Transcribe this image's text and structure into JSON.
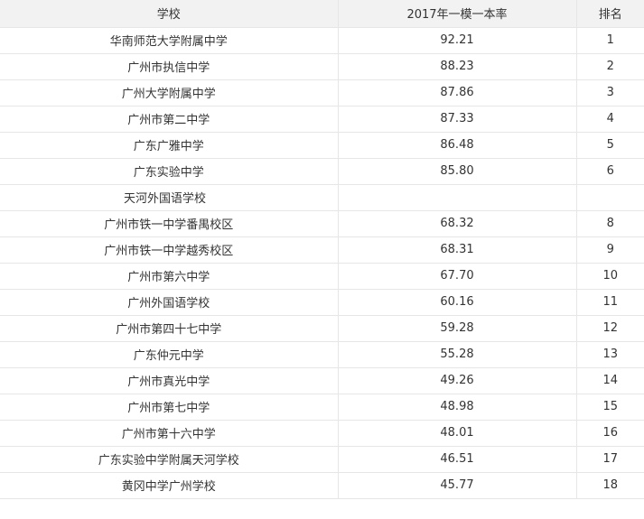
{
  "headers": [
    "学校",
    "2017年一模一本率",
    "排名"
  ],
  "rows": [
    {
      "school": "华南师范大学附属中学",
      "rate": "92.21",
      "rank": "1"
    },
    {
      "school": "广州市执信中学",
      "rate": "88.23",
      "rank": "2"
    },
    {
      "school": "广州大学附属中学",
      "rate": "87.86",
      "rank": "3"
    },
    {
      "school": "广州市第二中学",
      "rate": "87.33",
      "rank": "4"
    },
    {
      "school": "广东广雅中学",
      "rate": "86.48",
      "rank": "5"
    },
    {
      "school": "广东实验中学",
      "rate": "85.80",
      "rank": "6"
    },
    {
      "school": "天河外国语学校",
      "rate": "",
      "rank": ""
    },
    {
      "school": "广州市铁一中学番禺校区",
      "rate": "68.32",
      "rank": "8"
    },
    {
      "school": "广州市铁一中学越秀校区",
      "rate": "68.31",
      "rank": "9"
    },
    {
      "school": "广州市第六中学",
      "rate": "67.70",
      "rank": "10"
    },
    {
      "school": "广州外国语学校",
      "rate": "60.16",
      "rank": "11"
    },
    {
      "school": "广州市第四十七中学",
      "rate": "59.28",
      "rank": "12"
    },
    {
      "school": "广东仲元中学",
      "rate": "55.28",
      "rank": "13"
    },
    {
      "school": "广州市真光中学",
      "rate": "49.26",
      "rank": "14"
    },
    {
      "school": "广州市第七中学",
      "rate": "48.98",
      "rank": "15"
    },
    {
      "school": "广州市第十六中学",
      "rate": "48.01",
      "rank": "16"
    },
    {
      "school": "广东实验中学附属天河学校",
      "rate": "46.51",
      "rank": "17"
    },
    {
      "school": "黄冈中学广州学校",
      "rate": "45.77",
      "rank": "18"
    }
  ]
}
